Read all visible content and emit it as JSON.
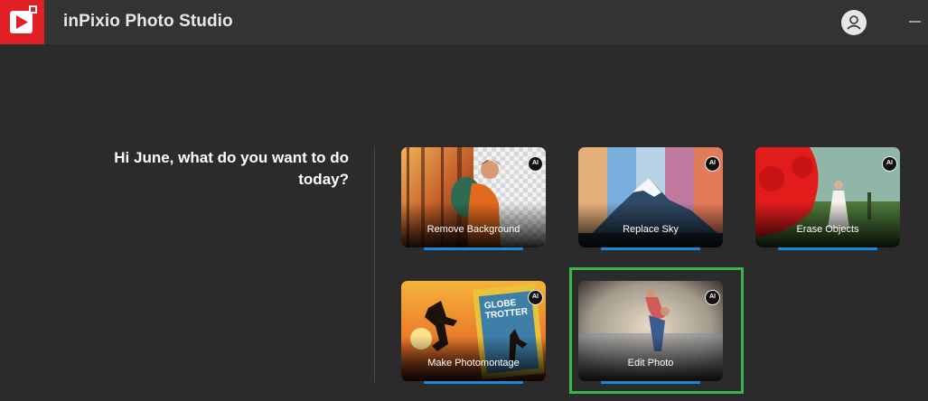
{
  "app": {
    "title": "inPixio Photo Studio"
  },
  "greeting": "Hi June, what do you want to do today?",
  "cards": [
    {
      "label": "Remove Background",
      "badge": "AI"
    },
    {
      "label": "Replace Sky",
      "badge": "AI"
    },
    {
      "label": "Erase Objects",
      "badge": "AI"
    },
    {
      "label": "Make Photomontage",
      "badge": "AI"
    },
    {
      "label": "Edit Photo",
      "badge": "AI"
    }
  ],
  "montage_text": [
    "GLOBE",
    "TROTTER"
  ],
  "colors": {
    "brand": "#e01f26",
    "accent_bar": "#1e88d8",
    "selection": "#3ab54a",
    "background": "#2b2b2b",
    "titlebar": "#333333"
  },
  "icons": {
    "logo": "play-logo-icon",
    "account": "user-icon",
    "window": "minimize-icon"
  }
}
